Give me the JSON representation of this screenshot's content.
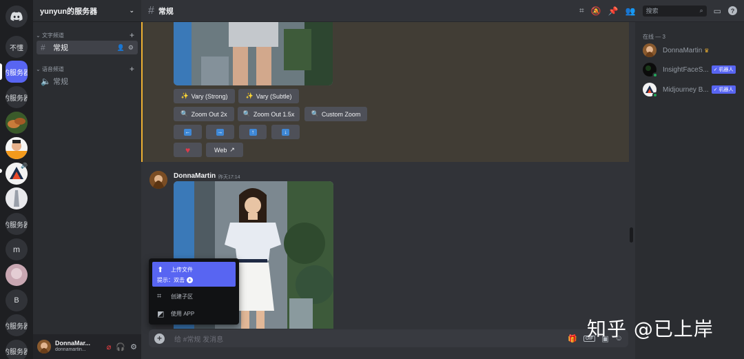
{
  "servers": {
    "home_label": "Discord",
    "items": [
      {
        "label": "不懂"
      },
      {
        "label": "的服务器",
        "active": true
      },
      {
        "label": "的服务器"
      },
      {
        "label": ""
      },
      {
        "label": ""
      },
      {
        "label": ""
      },
      {
        "label": ""
      },
      {
        "label": "的服务器"
      },
      {
        "label": "m"
      },
      {
        "label": ""
      },
      {
        "label": "B"
      },
      {
        "label": "的服务器"
      },
      {
        "label": "的服务器"
      }
    ]
  },
  "sidebar": {
    "server_name": "yunyun的服务器",
    "text_category": "文字频道",
    "voice_category": "语音频道",
    "text_channel": "常规",
    "voice_channel": "常规"
  },
  "user": {
    "name": "DonnaMar...",
    "tag": "donnamartin..."
  },
  "header": {
    "channel": "常规",
    "search_placeholder": "搜索"
  },
  "message_top": {
    "buttons_row1": [
      {
        "label": "Vary (Strong)",
        "icon": "sparkle-icon"
      },
      {
        "label": "Vary (Subtle)",
        "icon": "sparkle-icon"
      }
    ],
    "buttons_row2": [
      {
        "label": "Zoom Out 2x",
        "icon": "magnifier-icon"
      },
      {
        "label": "Zoom Out 1.5x",
        "icon": "magnifier-icon"
      },
      {
        "label": "Custom Zoom",
        "icon": "magnifier-icon"
      }
    ],
    "arrows": [
      "←",
      "→",
      "↑",
      "↓"
    ],
    "web_label": "Web"
  },
  "message": {
    "author": "DonnaMartin",
    "time": "昨天17:14"
  },
  "popup": {
    "upload": "上传文件",
    "upload_hint": "提示：双击",
    "thread": "创建子区",
    "app": "使用 APP"
  },
  "composer": {
    "placeholder": "给 #常规 发消息",
    "gif": "GIF"
  },
  "members": {
    "header": "在线 — 3",
    "list": [
      {
        "name": "DonnaMartin",
        "badge": "",
        "crown": true
      },
      {
        "name": "InsightFaceS...",
        "badge": "✓ 机器人",
        "crown": false
      },
      {
        "name": "Midjourney B...",
        "badge": "✓ 机器人",
        "crown": false
      }
    ]
  },
  "watermark": "知乎 @已上岸",
  "colors": {
    "accent": "#5865f2",
    "highlight_bg": "#413d35",
    "highlight_bar": "#f0b232",
    "online": "#23a55a"
  }
}
